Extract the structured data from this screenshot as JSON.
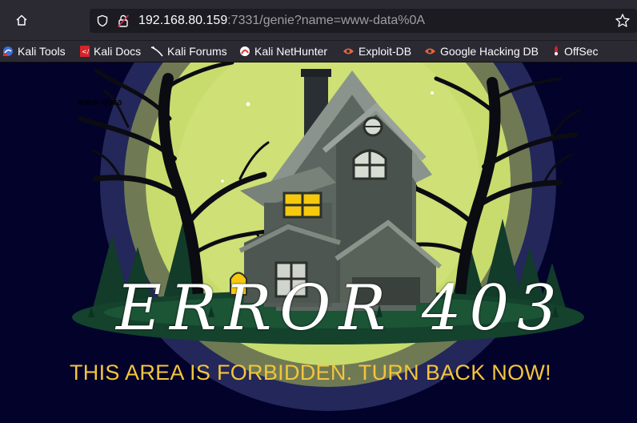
{
  "browser": {
    "url_host": "192.168.80.159",
    "url_rest": ":7331/genie?name=www-data%0A",
    "bookmarks": [
      {
        "label": "Kali Tools",
        "icon": "kali-dragon-icon"
      },
      {
        "label": "Kali Docs",
        "icon": "kali-docs-icon"
      },
      {
        "label": "Kali Forums",
        "icon": "kali-forums-icon"
      },
      {
        "label": "Kali NetHunter",
        "icon": "kali-nethunter-icon"
      },
      {
        "label": "Exploit-DB",
        "icon": "exploit-db-icon"
      },
      {
        "label": "Google Hacking DB",
        "icon": "ghdb-icon"
      },
      {
        "label": "OffSec",
        "icon": "offsec-icon"
      }
    ]
  },
  "page": {
    "command_output": "www-data",
    "error_title": "ERROR 403",
    "error_message": "THIS AREA IS FORBIDDEN. TURN BACK NOW!",
    "colors": {
      "background": "#02022a",
      "moon": "#c8dc6e",
      "message": "#f4c53b",
      "window_light": "#f6c90e"
    }
  }
}
